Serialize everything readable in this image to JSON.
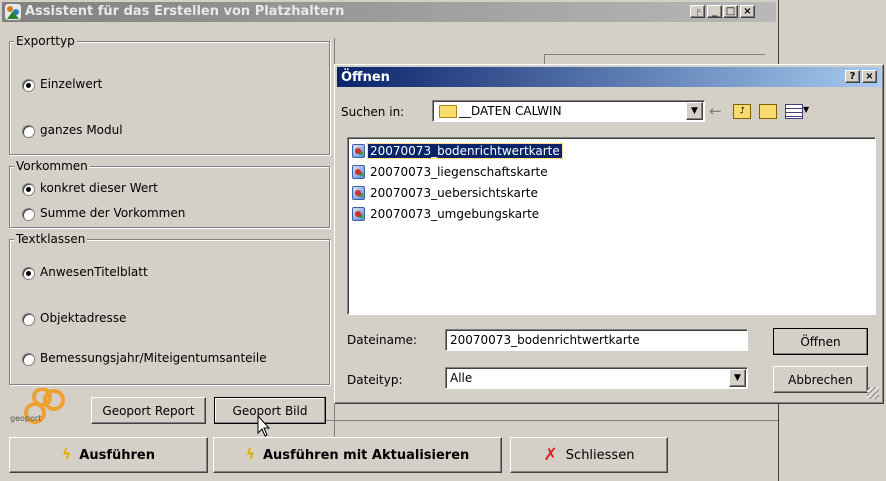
{
  "main_window": {
    "title": "Assistent für das Erstellen von Platzhaltern",
    "export_group": {
      "legend": "Exporttyp",
      "options": [
        {
          "label": "Einzelwert",
          "selected": true
        },
        {
          "label": "ganzes Modul",
          "selected": false
        }
      ]
    },
    "vorkommen_group": {
      "legend": "Vorkommen",
      "options": [
        {
          "label": "konkret dieser Wert",
          "selected": true
        },
        {
          "label": "Summe der Vorkommen",
          "selected": false
        }
      ]
    },
    "text_group": {
      "legend": "Textklassen",
      "options": [
        {
          "label": "AnwesenTitelblatt",
          "selected": true
        },
        {
          "label": "Objektadresse",
          "selected": false
        },
        {
          "label": "Bemessungsjahr/Miteigentumsanteile",
          "selected": false
        }
      ]
    },
    "logo_text": "geoport",
    "buttons": {
      "report": "Geoport Report",
      "bild": "Geoport Bild",
      "ausfuehren": "Ausführen",
      "ausfuehren_akt": "Ausführen mit Aktualisieren",
      "schliessen": "Schliessen"
    }
  },
  "open_dialog": {
    "title": "Öffnen",
    "help_btn": "?",
    "close_btn": "×",
    "look_in_label": "Suchen in:",
    "look_in_value": "__DATEN CALWIN",
    "files": [
      {
        "name": "20070073_bodenrichtwertkarte",
        "selected": true
      },
      {
        "name": "20070073_liegenschaftskarte",
        "selected": false
      },
      {
        "name": "20070073_uebersichtskarte",
        "selected": false
      },
      {
        "name": "20070073_umgebungskarte",
        "selected": false
      }
    ],
    "filename_label": "Dateiname:",
    "filename_value": "20070073_bodenrichtwertkarte",
    "filetype_label": "Dateityp:",
    "filetype_value": "Alle",
    "open_button": "Öffnen",
    "cancel_button": "Abbrechen"
  },
  "colors": {
    "title_active_start": "#0a246a",
    "title_active_end": "#a6caf0",
    "title_inactive": "#808080",
    "selection": "#0a246a",
    "close_x": "#e02020",
    "lightning": "#f0c000"
  },
  "icons": {
    "app": "app-icon",
    "folder": "folder-icon",
    "back": "back-arrow-icon",
    "up": "folder-up-icon",
    "new_folder": "new-folder-icon",
    "view": "view-menu-icon",
    "file": "image-file-icon",
    "run": "lightning-icon",
    "close": "red-x-icon",
    "cursor": "mouse-pointer-icon"
  }
}
